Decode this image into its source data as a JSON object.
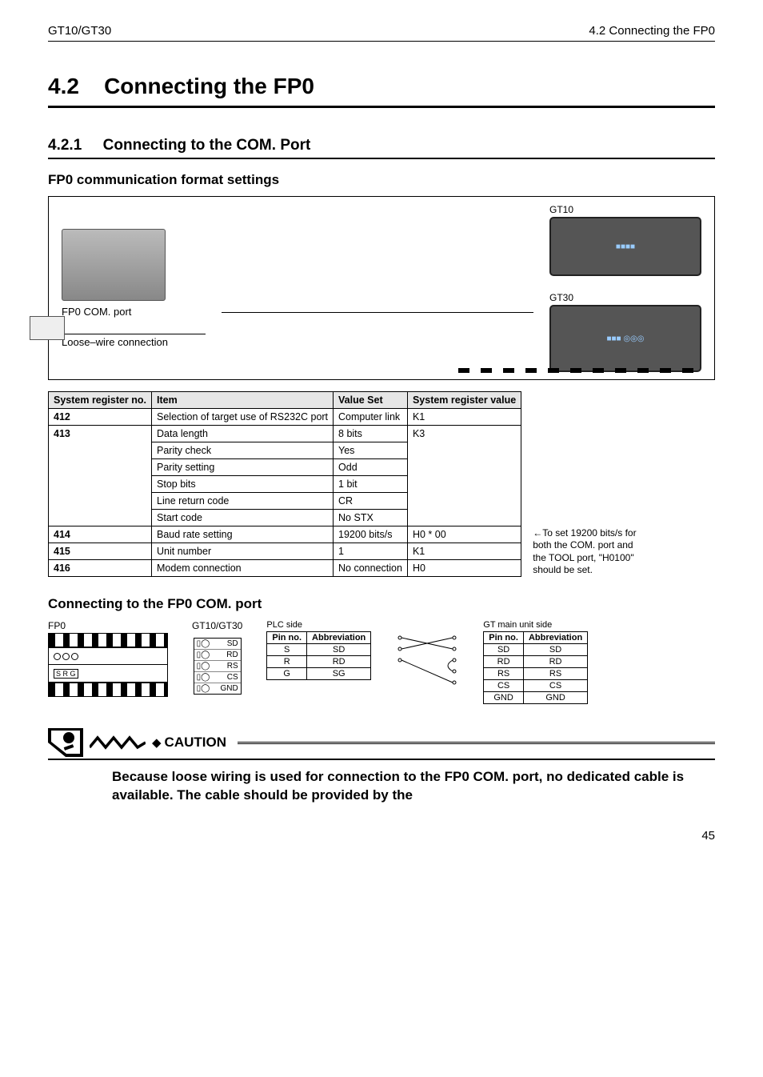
{
  "header": {
    "left": "GT10/GT30",
    "right": "4.2   Connecting the FP0"
  },
  "section": {
    "number": "4.2",
    "title": "Connecting the FP0"
  },
  "subsection": {
    "number": "4.2.1",
    "title": "Connecting to the COM. Port"
  },
  "blocks": {
    "fp0_format_title": "FP0 communication format settings",
    "connect_port_title": "Connecting to the FP0 COM. port"
  },
  "figure1": {
    "port_label": "FP0 COM. port",
    "conn_label": "Loose–wire connection",
    "gt10_label": "GT10",
    "gt30_label": "GT30"
  },
  "reg_table": {
    "headers": [
      "System register no.",
      "Item",
      "Value Set",
      "System register value"
    ],
    "rows": [
      {
        "no": "412",
        "item": "Selection of target use of RS232C port",
        "value": "Computer link",
        "srv": "K1"
      },
      {
        "no": "413",
        "item": "Data length",
        "value": "8 bits",
        "srv": "K3",
        "rowspan_no": 6,
        "rowspan_srv": 6
      },
      {
        "item": "Parity check",
        "value": "Yes"
      },
      {
        "item": "Parity setting",
        "value": "Odd"
      },
      {
        "item": "Stop bits",
        "value": "1 bit"
      },
      {
        "item": "Line return code",
        "value": "CR"
      },
      {
        "item": "Start code",
        "value": "No STX"
      },
      {
        "no": "414",
        "item": "Baud rate setting",
        "value": "19200 bits/s",
        "srv": "H0 * 00"
      },
      {
        "no": "415",
        "item": "Unit number",
        "value": "1",
        "srv": "K1"
      },
      {
        "no": "416",
        "item": "Modem connection",
        "value": "No connection",
        "srv": "H0"
      }
    ],
    "note_arrow": "←",
    "note": "To set 19200 bits/s for both the COM. port and the TOOL port, \"H0100\" should be set."
  },
  "wiring": {
    "fp0_label": "FP0",
    "gt_label": "GT10/GT30",
    "srg_label": "S R G",
    "term_labels": [
      "SD",
      "RD",
      "RS",
      "CS",
      "GND"
    ],
    "plc_side_title": "PLC side",
    "gt_side_title": "GT main unit side",
    "plc_pins": {
      "headers": [
        "Pin no.",
        "Abbreviation"
      ],
      "rows": [
        [
          "S",
          "SD"
        ],
        [
          "R",
          "RD"
        ],
        [
          "G",
          "SG"
        ]
      ]
    },
    "gt_pins": {
      "headers": [
        "Pin no.",
        "Abbreviation"
      ],
      "rows": [
        [
          "SD",
          "SD"
        ],
        [
          "RD",
          "RD"
        ],
        [
          "RS",
          "RS"
        ],
        [
          "CS",
          "CS"
        ],
        [
          "GND",
          "GND"
        ]
      ]
    }
  },
  "caution": {
    "bullet": "◆",
    "label": "CAUTION",
    "text": "Because loose wiring is used for connection to the FP0 COM. port, no dedicated cable is available. The cable should be provided by the"
  },
  "page_number": "45"
}
